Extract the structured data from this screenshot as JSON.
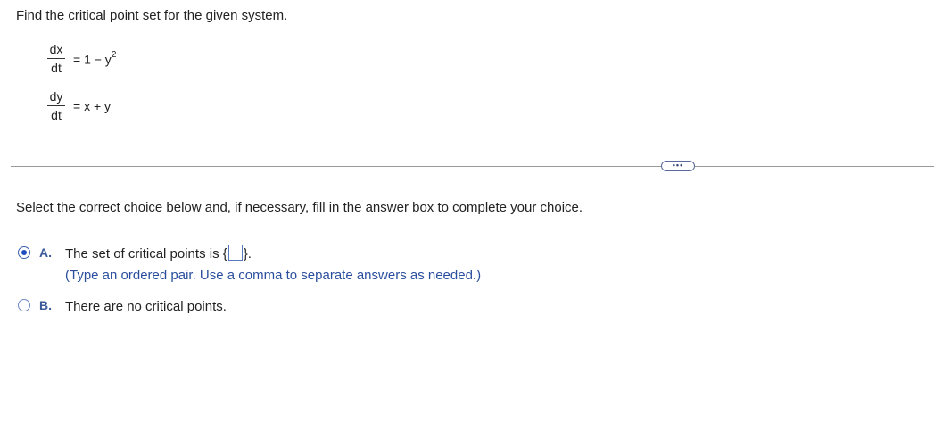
{
  "question": {
    "text": "Find the critical point set for the given system."
  },
  "equations": [
    {
      "num": "dx",
      "den": "dt",
      "rhs_base": "= 1 − y",
      "rhs_sup": "2"
    },
    {
      "num": "dy",
      "den": "dt",
      "rhs_base": "= x + y",
      "rhs_sup": ""
    }
  ],
  "more_button": {
    "label": "•••"
  },
  "instruction": "Select the correct choice below and, if necessary, fill in the answer box to complete your choice.",
  "choices": [
    {
      "letter": "A.",
      "text_before": "The set of critical points is {",
      "text_after": "}.",
      "hint": "(Type an ordered pair. Use a comma to separate answers as needed.)",
      "selected": true,
      "answer_value": ""
    },
    {
      "letter": "B.",
      "text": "There are no critical points.",
      "selected": false
    }
  ],
  "colors": {
    "accent": "#3a5a9a",
    "hint": "#2a4f9e",
    "divider": "#999999"
  }
}
